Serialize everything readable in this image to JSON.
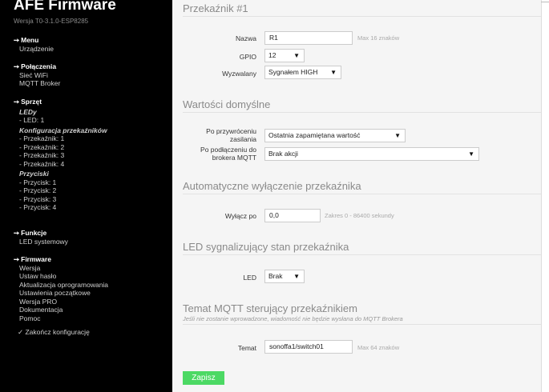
{
  "sidebar": {
    "brand": "AFE Firmware",
    "version": "Wersja T0-3.1.0-ESP8285",
    "menu": {
      "title": "Menu",
      "items": [
        "Urządzenie"
      ]
    },
    "connections": {
      "title": "Połączenia",
      "items": [
        "Sieć WiFi",
        "MQTT Broker"
      ]
    },
    "hardware": {
      "title": "Sprzęt",
      "leds": {
        "title": "LEDy",
        "items": [
          "- LED: 1"
        ]
      },
      "relays": {
        "title": "Konfiguracja przekaźników",
        "items": [
          "- Przekaźnik: 1",
          "- Przekaźnik: 2",
          "- Przekaźnik: 3",
          "- Przekaźnik: 4"
        ]
      },
      "buttons": {
        "title": "Przyciski",
        "items": [
          "- Przycisk: 1",
          "- Przycisk: 2",
          "- Przycisk: 3",
          "- Przycisk: 4"
        ]
      }
    },
    "functions": {
      "title": "Funkcje",
      "items": [
        "LED systemowy"
      ]
    },
    "firmware": {
      "title": "Firmware",
      "items": [
        "Wersja",
        "Ustaw hasło",
        "Aktualizacja oprogramowania",
        "Ustawienia początkowe",
        "Wersja PRO",
        "Dokumentacja",
        "Pomoc"
      ]
    },
    "finish": "✓ Zakończ konfigurację"
  },
  "relay": {
    "title": "Przekaźnik #1",
    "name_label": "Nazwa",
    "name_value": "R1",
    "name_hint": "Max 16 znaków",
    "gpio_label": "GPIO",
    "gpio_value": "12",
    "trigger_label": "Wyzwalany",
    "trigger_value": "Sygnałem HIGH"
  },
  "defaults": {
    "title": "Wartości domyślne",
    "power_label_1": "Po przywróceniu",
    "power_label_2": "zasilania",
    "power_value": "Ostatnia zapamiętana wartość",
    "mqtt_label_1": "Po podłączeniu do",
    "mqtt_label_2": "brokera MQTT",
    "mqtt_value": "Brak akcji"
  },
  "auto_off": {
    "title": "Automatyczne wyłączenie przekaźnika",
    "label": "Wyłącz po",
    "value": "0,0",
    "hint": "Zakres 0 - 86400 sekundy"
  },
  "led": {
    "title": "LED sygnalizujący stan przekaźnika",
    "label": "LED",
    "value": "Brak"
  },
  "mqtt_topic": {
    "title": "Temat MQTT sterujący przekaźnikiem",
    "description": "Jeśli nie zostanie wprowadzone, wiadomość nie będzie wysłana do MQTT Brokera",
    "label": "Temat",
    "value": "sonoffa1/switch01",
    "hint": "Max 64 znaków"
  },
  "save_label": "Zapisz",
  "icons": {
    "section_arrow": "arrow-right-icon",
    "dropdown": "caret-down-icon"
  },
  "colors": {
    "sidebar_bg": "#000000",
    "content_bg": "#f5f5f5",
    "save_button": "#4cd964"
  }
}
